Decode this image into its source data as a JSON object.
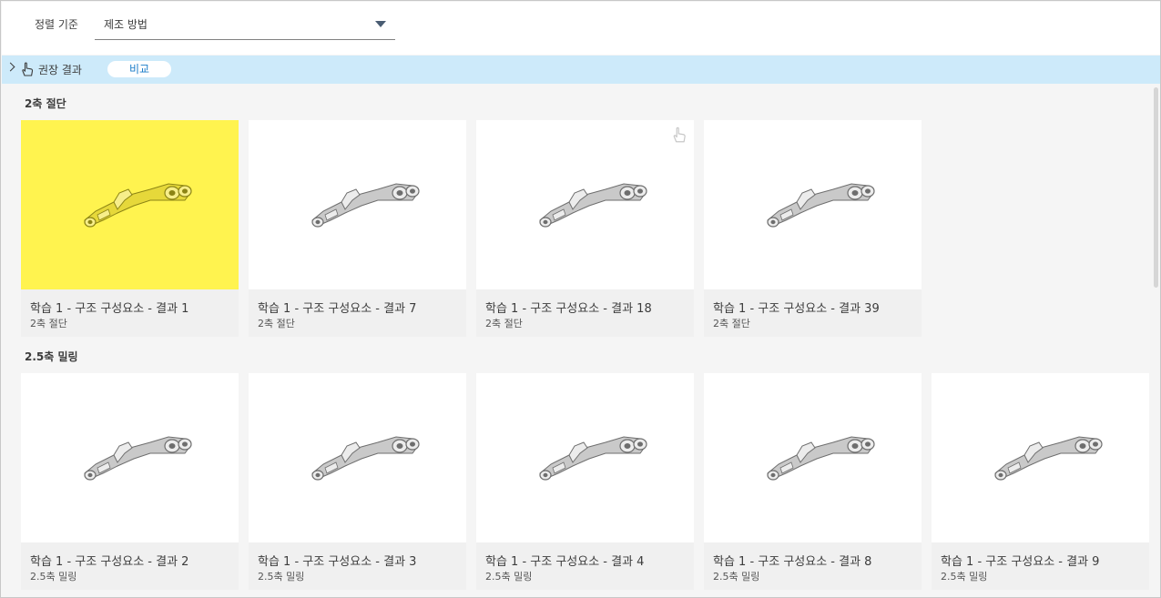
{
  "sort": {
    "label": "정렬 기준",
    "value": "제조 방법"
  },
  "recommended": {
    "label": "권장 결과",
    "compare_label": "비교",
    "icon": "hand-pointer-icon"
  },
  "groups": [
    {
      "title": "2축 절단",
      "cards": [
        {
          "name": "학습 1 - 구조 구성요소 - 결과 1",
          "method": "2축 절단",
          "selected": true,
          "recommended": false
        },
        {
          "name": "학습 1 - 구조 구성요소 - 결과 7",
          "method": "2축 절단",
          "selected": false,
          "recommended": false
        },
        {
          "name": "학습 1 - 구조 구성요소 - 결과 18",
          "method": "2축 절단",
          "selected": false,
          "recommended": true
        },
        {
          "name": "학습 1 - 구조 구성요소 - 결과 39",
          "method": "2축 절단",
          "selected": false,
          "recommended": false
        }
      ]
    },
    {
      "title": "2.5축 밀링",
      "cards": [
        {
          "name": "학습 1 - 구조 구성요소 - 결과 2",
          "method": "2.5축 밀링",
          "selected": false,
          "recommended": false
        },
        {
          "name": "학습 1 - 구조 구성요소 - 결과 3",
          "method": "2.5축 밀링",
          "selected": false,
          "recommended": false
        },
        {
          "name": "학습 1 - 구조 구성요소 - 결과 4",
          "method": "2.5축 밀링",
          "selected": false,
          "recommended": false
        },
        {
          "name": "학습 1 - 구조 구성요소 - 결과 8",
          "method": "2.5축 밀링",
          "selected": false,
          "recommended": false
        },
        {
          "name": "학습 1 - 구조 구성요소 - 결과 9",
          "method": "2.5축 밀링",
          "selected": false,
          "recommended": false
        }
      ]
    }
  ],
  "colors": {
    "selected_thumb": "#fff34f",
    "recommended_bar": "#cdeafa",
    "compare_text": "#1c7ec9"
  }
}
